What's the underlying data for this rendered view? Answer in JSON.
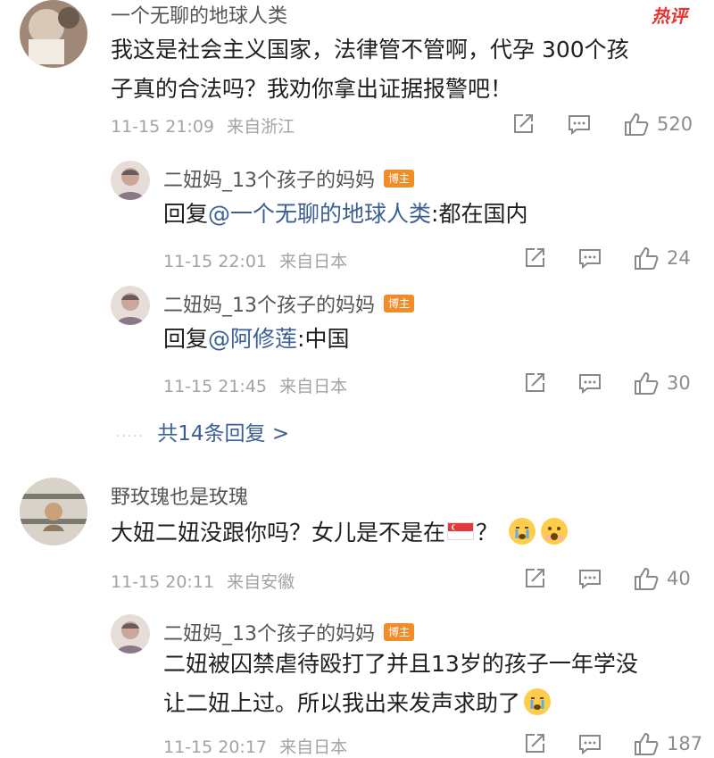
{
  "comments": [
    {
      "username": "一个无聊的地球人类",
      "hot_badge": "热评",
      "text": "我这是社会主义国家，法律管不管啊，代孕300个孩子真的合法吗？我劝你拿出证据报警吧！",
      "line1": "我这是社会主义国家，法律管不管啊，代孕 300个孩",
      "line2": "子真的合法吗？我劝你拿出证据报警吧！",
      "time": "11-15 21:09",
      "location": "来自浙江",
      "likes": "520"
    },
    {
      "username": "野玫瑰也是玫瑰",
      "text_before": "大妞二妞没跟你吗？女儿是不是在",
      "text_after": "？",
      "flag_icon": "singapore-flag-icon",
      "emoji_icons": [
        "crying-face-icon",
        "fearful-face-icon"
      ],
      "time": "11-15 20:11",
      "location": "来自安徽",
      "likes": "40"
    }
  ],
  "replies": [
    {
      "username": "二妞妈_13个孩子的妈妈",
      "badge": "博主",
      "prefix": "回复",
      "mention": "@一个无聊的地球人类",
      "content": ":都在国内",
      "time": "11-15 22:01",
      "location": "来自日本",
      "likes": "24"
    },
    {
      "username": "二妞妈_13个孩子的妈妈",
      "badge": "博主",
      "prefix": "回复",
      "mention": "@阿修莲",
      "content": ":中国",
      "time": "11-15 21:45",
      "location": "来自日本",
      "likes": "30"
    },
    {
      "username": "二妞妈_13个孩子的妈妈",
      "badge": "博主",
      "line1": "二妞被囚禁虐待殴打了并且13岁的孩子一年学没",
      "line2": "让二妞上过。所以我出来发声求助了",
      "emoji_icon": "crying-face-icon",
      "time": "11-15 20:17",
      "location": "来自日本",
      "likes": "187"
    }
  ],
  "more_replies": {
    "dots": "·····",
    "label": "共14条回复 >"
  },
  "icons": [
    "share-icon",
    "comment-icon",
    "like-icon"
  ],
  "colors": {
    "link": "#3b5f93",
    "badge": "#f08c2a",
    "hot": "#e8332e",
    "meta": "#a3a3a3"
  }
}
